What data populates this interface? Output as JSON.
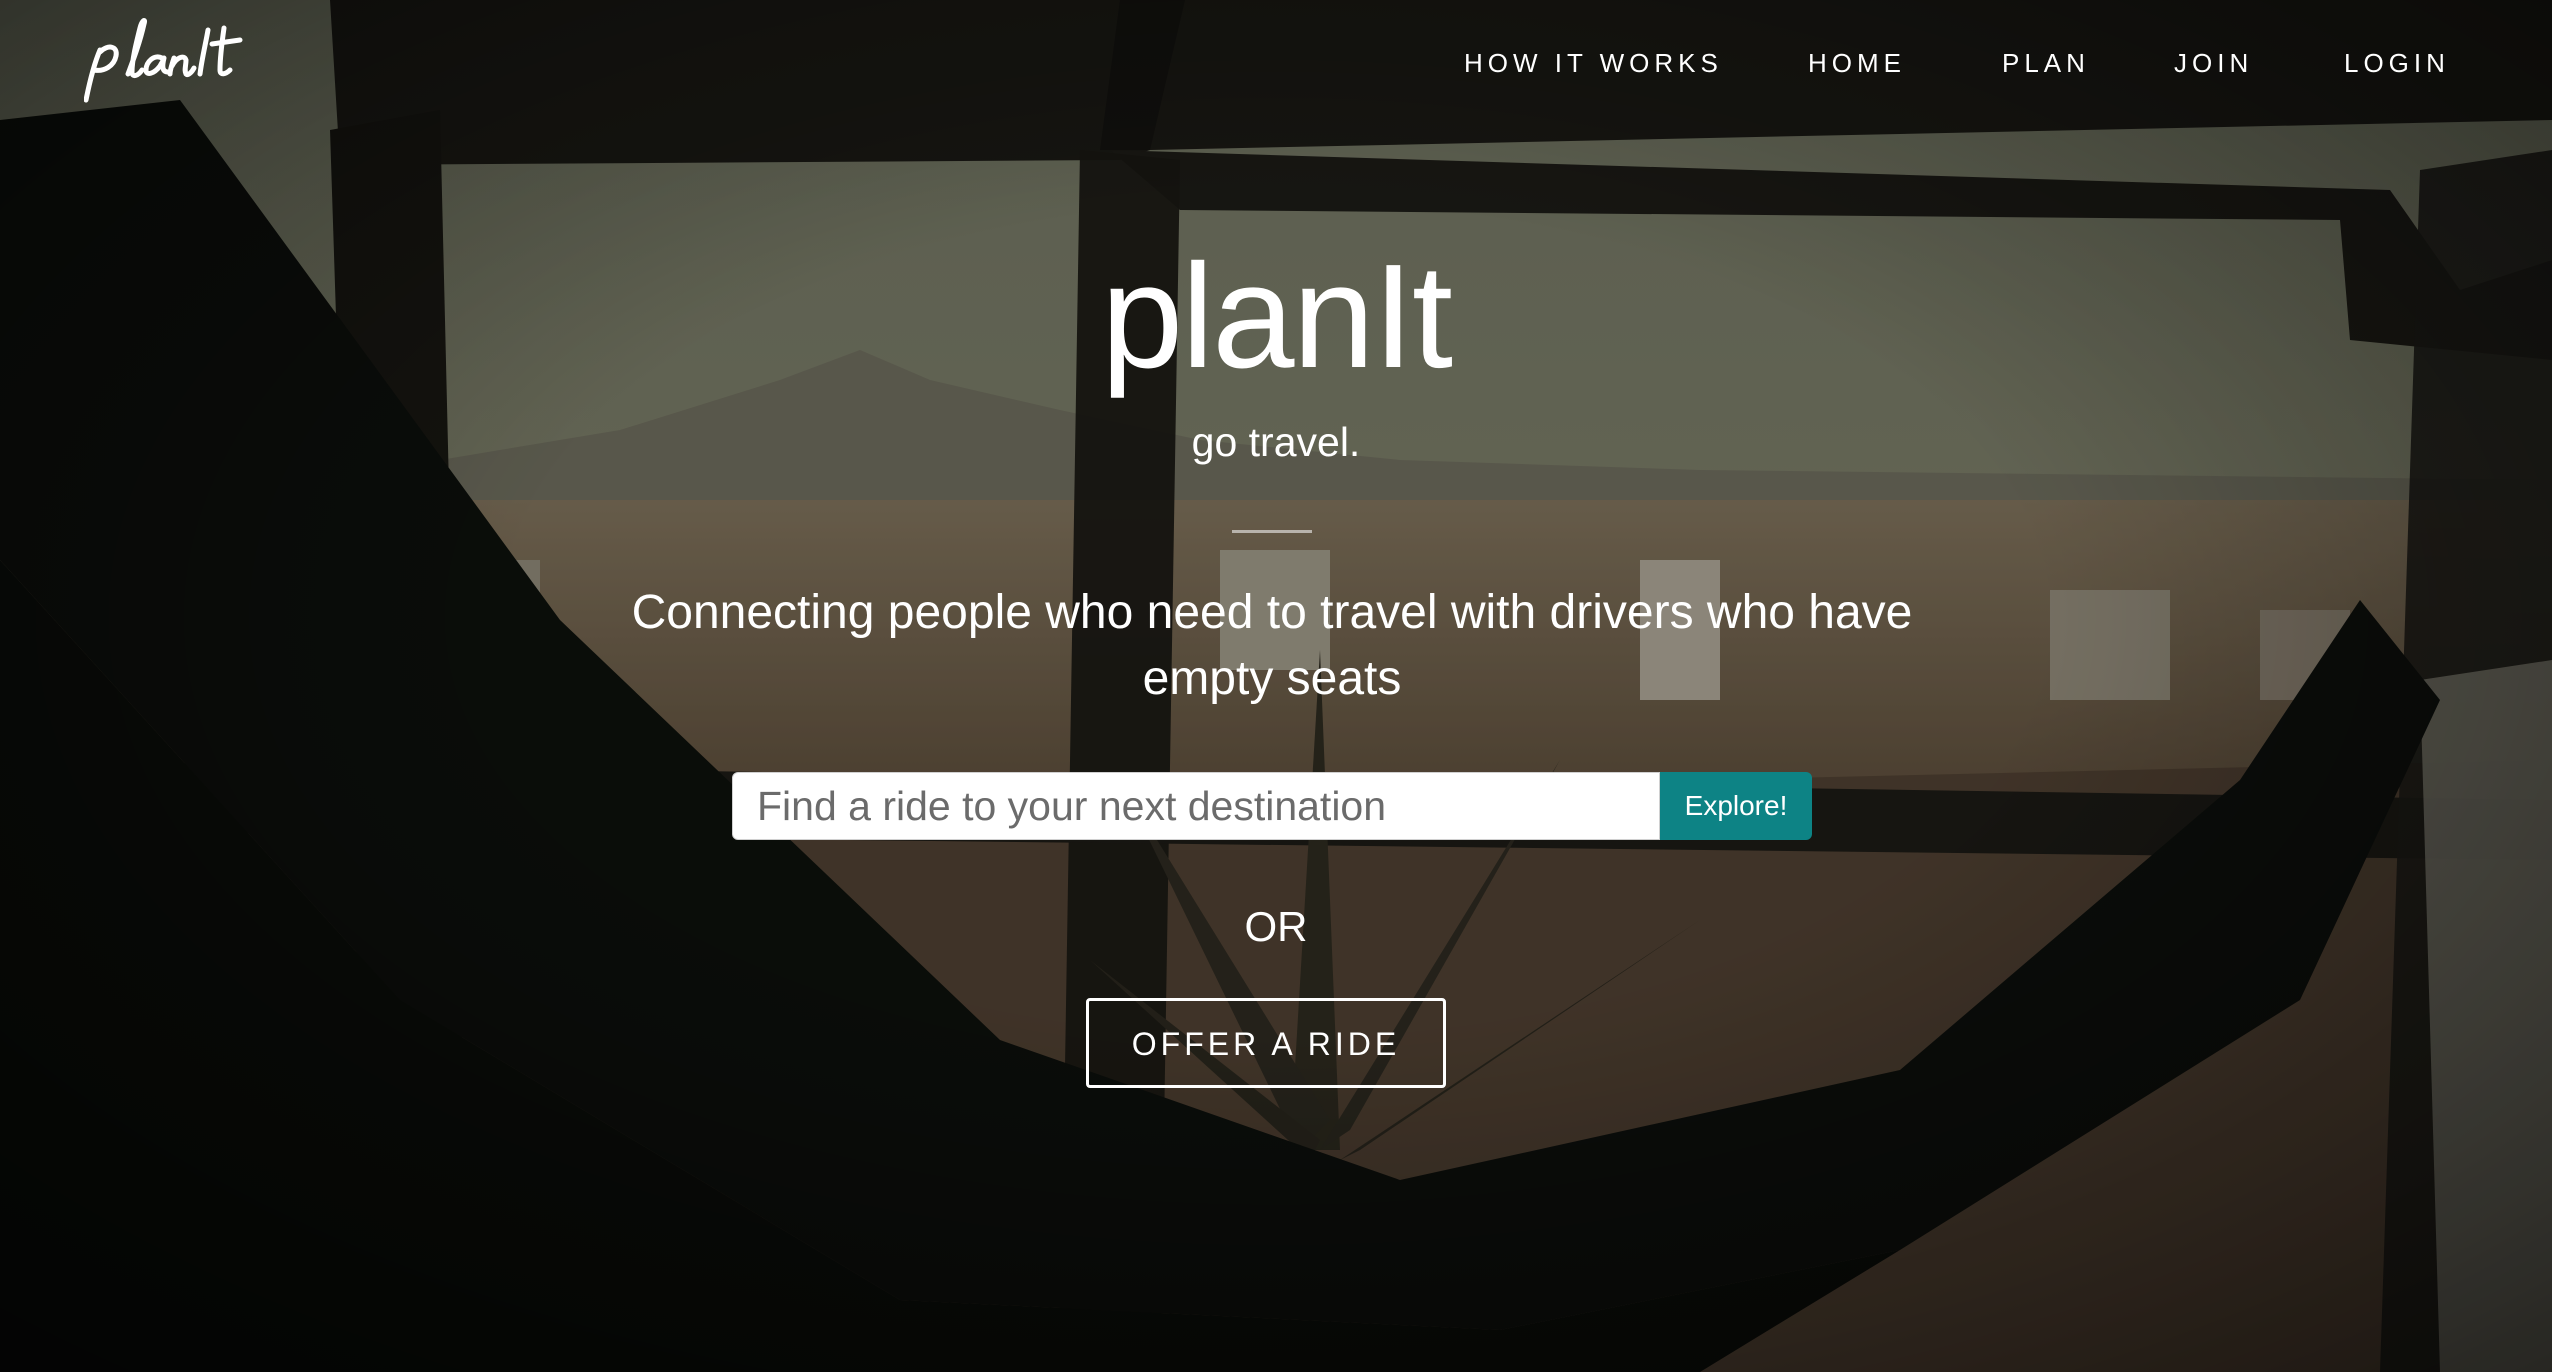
{
  "app": {
    "logo_text": "planIt"
  },
  "nav": {
    "items": [
      {
        "label": "HOW IT WORKS"
      },
      {
        "label": "HOME"
      },
      {
        "label": "PLAN"
      },
      {
        "label": "JOIN"
      },
      {
        "label": "LOGIN"
      }
    ]
  },
  "hero": {
    "title": "planIt",
    "subtitle": "go travel.",
    "tagline": "Connecting people who need to travel with drivers who have empty seats"
  },
  "search": {
    "placeholder": "Find a ride to your next destination",
    "value": "",
    "button_label": "Explore!"
  },
  "or_text": "OR",
  "offer": {
    "button_label": "OFFER A RIDE"
  },
  "colors": {
    "accent": "#0d8385",
    "text": "#ffffff",
    "background": "#2b2a23"
  },
  "icons": {
    "brand": "planit-script-logo"
  }
}
